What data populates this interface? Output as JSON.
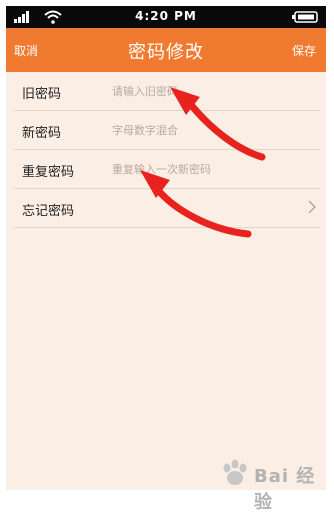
{
  "status_bar": {
    "time": "4:20 PM",
    "signal_icon": "signal-bars-icon",
    "wifi_icon": "wifi-icon",
    "battery_icon": "battery-icon"
  },
  "nav": {
    "left_label": "取消",
    "title": "密码修改",
    "right_label": "保存",
    "background": "#f17a31"
  },
  "form": {
    "rows": [
      {
        "label": "旧密码",
        "placeholder": "请输入旧密码",
        "value": ""
      },
      {
        "label": "新密码",
        "placeholder": "字母数字混合",
        "value": ""
      },
      {
        "label": "重复密码",
        "placeholder": "重复输入一次新密码",
        "value": ""
      },
      {
        "label": "忘记密码",
        "chevron_icon": "chevron-right-icon"
      }
    ]
  },
  "annotations": {
    "arrow_color": "#e8231f",
    "arrow_icon": "red-arrow-icon"
  },
  "watermark": {
    "text": "Bai 经验",
    "paw_icon": "baidu-paw-icon"
  }
}
